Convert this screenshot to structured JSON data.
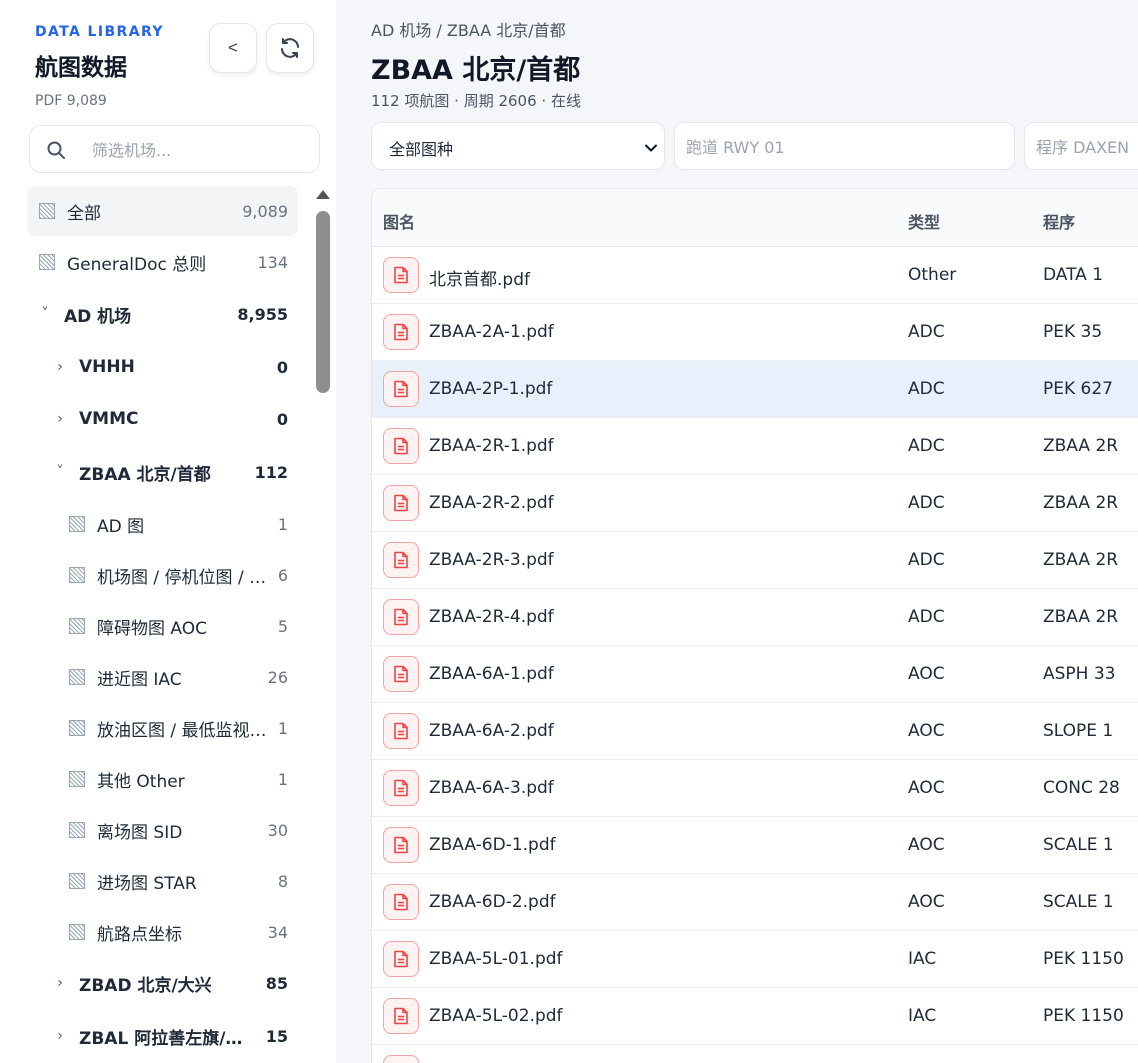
{
  "sidebar": {
    "tag": "DATA LIBRARY",
    "title": "航图数据",
    "total": "PDF 9,089",
    "collapse_label": "<",
    "filter_placeholder": "筛选机场...",
    "items": [
      {
        "label": "全部",
        "count": "9,089",
        "kind": "file",
        "depth": 0,
        "active": true,
        "bold": false
      },
      {
        "label": "GeneralDoc 总则",
        "count": "134",
        "kind": "file",
        "depth": 0,
        "active": false,
        "bold": false
      },
      {
        "label": "AD 机场",
        "count": "8,955",
        "kind": "expanded",
        "depth": 0,
        "active": false,
        "bold": true
      },
      {
        "label": "VHHH",
        "count": "0",
        "kind": "collapsed",
        "depth": 1,
        "active": false,
        "bold": true
      },
      {
        "label": "VMMC",
        "count": "0",
        "kind": "collapsed",
        "depth": 1,
        "active": false,
        "bold": true
      },
      {
        "label": "ZBAA 北京/首都",
        "count": "112",
        "kind": "expanded",
        "depth": 1,
        "active": false,
        "bold": true
      },
      {
        "label": "AD 图",
        "count": "1",
        "kind": "file",
        "depth": 2,
        "active": false,
        "bold": false
      },
      {
        "label": "机场图 / 停机位图 / 地面活动图",
        "count": "6",
        "kind": "file",
        "depth": 2,
        "active": false,
        "bold": false
      },
      {
        "label": "障碍物图 AOC",
        "count": "5",
        "kind": "file",
        "depth": 2,
        "active": false,
        "bold": false
      },
      {
        "label": "进近图 IAC",
        "count": "26",
        "kind": "file",
        "depth": 2,
        "active": false,
        "bold": false
      },
      {
        "label": "放油区图 / 最低监视引导高度图",
        "count": "1",
        "kind": "file",
        "depth": 2,
        "active": false,
        "bold": false
      },
      {
        "label": "其他 Other",
        "count": "1",
        "kind": "file",
        "depth": 2,
        "active": false,
        "bold": false
      },
      {
        "label": "离场图 SID",
        "count": "30",
        "kind": "file",
        "depth": 2,
        "active": false,
        "bold": false
      },
      {
        "label": "进场图 STAR",
        "count": "8",
        "kind": "file",
        "depth": 2,
        "active": false,
        "bold": false
      },
      {
        "label": "航路点坐标",
        "count": "34",
        "kind": "file",
        "depth": 2,
        "active": false,
        "bold": false
      },
      {
        "label": "ZBAD 北京/大兴",
        "count": "85",
        "kind": "collapsed",
        "depth": 1,
        "active": false,
        "bold": true
      },
      {
        "label": "ZBAL 阿拉善左旗/巴彦浩特",
        "count": "15",
        "kind": "collapsed",
        "depth": 1,
        "active": false,
        "bold": true
      }
    ]
  },
  "main": {
    "breadcrumb": "AD 机场 / ZBAA 北京/首都",
    "title": "ZBAA 北京/首都",
    "subtitle": "112 项航图 · 周期 2606 · 在线",
    "filters": {
      "type_value": "全部图种",
      "runway_placeholder": "跑道 RWY 01",
      "procedure_placeholder": "程序 DAXEN"
    },
    "table": {
      "headers": {
        "name": "图名",
        "type": "类型",
        "procedure": "程序"
      },
      "rows": [
        {
          "name": "北京首都.pdf",
          "type": "Other",
          "procedure": "DATA 1",
          "selected": false
        },
        {
          "name": "ZBAA-2A-1.pdf",
          "type": "ADC",
          "procedure": "PEK 35",
          "selected": false
        },
        {
          "name": "ZBAA-2P-1.pdf",
          "type": "ADC",
          "procedure": "PEK 627",
          "selected": true
        },
        {
          "name": "ZBAA-2R-1.pdf",
          "type": "ADC",
          "procedure": "ZBAA 2R",
          "selected": false
        },
        {
          "name": "ZBAA-2R-2.pdf",
          "type": "ADC",
          "procedure": "ZBAA 2R",
          "selected": false
        },
        {
          "name": "ZBAA-2R-3.pdf",
          "type": "ADC",
          "procedure": "ZBAA 2R",
          "selected": false
        },
        {
          "name": "ZBAA-2R-4.pdf",
          "type": "ADC",
          "procedure": "ZBAA 2R",
          "selected": false
        },
        {
          "name": "ZBAA-6A-1.pdf",
          "type": "AOC",
          "procedure": "ASPH 33",
          "selected": false
        },
        {
          "name": "ZBAA-6A-2.pdf",
          "type": "AOC",
          "procedure": "SLOPE 1",
          "selected": false
        },
        {
          "name": "ZBAA-6A-3.pdf",
          "type": "AOC",
          "procedure": "CONC 28",
          "selected": false
        },
        {
          "name": "ZBAA-6D-1.pdf",
          "type": "AOC",
          "procedure": "SCALE 1",
          "selected": false
        },
        {
          "name": "ZBAA-6D-2.pdf",
          "type": "AOC",
          "procedure": "SCALE 1",
          "selected": false
        },
        {
          "name": "ZBAA-5L-01.pdf",
          "type": "IAC",
          "procedure": "PEK 1150",
          "selected": false
        },
        {
          "name": "ZBAA-5L-02.pdf",
          "type": "IAC",
          "procedure": "PEK 1150",
          "selected": false
        },
        {
          "name": "",
          "type": "",
          "procedure": "",
          "selected": false
        }
      ]
    }
  },
  "colors": {
    "accent": "#2563eb",
    "pdf_icon": "#ef4444",
    "selected_row": "#e8f0fc"
  },
  "icons": {
    "collapse": "chevron-left-icon",
    "refresh": "refresh-icon",
    "search": "search-icon",
    "file": "file-icon",
    "pdf": "pdf-file-icon"
  }
}
